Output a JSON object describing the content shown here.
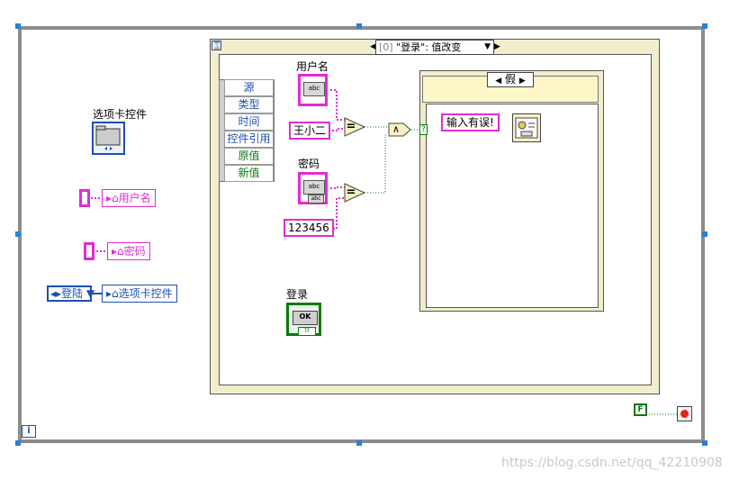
{
  "event_structure": {
    "selector": {
      "index": "[0]",
      "label": "\"登录\": 值改变"
    },
    "data_node": [
      {
        "label": "源",
        "color": "#1d4fb3"
      },
      {
        "label": "类型",
        "color": "#1d4fb3"
      },
      {
        "label": "时间",
        "color": "#1d4fb3"
      },
      {
        "label": "控件引用",
        "color": "#1d4fb3"
      },
      {
        "label": "原值",
        "color": "#0a7a0a"
      },
      {
        "label": "新值",
        "color": "#0a7a0a"
      }
    ]
  },
  "controls": {
    "username_label": "用户名",
    "username_constant": "王小二",
    "password_label": "密码",
    "password_constant": "123456",
    "login_label": "登录",
    "login_button_text": "OK",
    "login_tf_text": "TF"
  },
  "case_structure": {
    "selector": "假",
    "message": "输入有误!"
  },
  "left_column": {
    "tab_control_label": "选项卡控件",
    "username_local": "用户名",
    "password_local": "密码",
    "enum_value": "登陆",
    "tab_local": "选项卡控件"
  },
  "loop": {
    "iteration": "i",
    "false_constant": "F"
  },
  "node_glyphs": {
    "equal": "=",
    "and": "∧",
    "case_q": "?",
    "abc": "abc"
  },
  "colors": {
    "string_wire": "#e22bd6",
    "boolean_wire": "#0a7a0a",
    "enum": "#1d4fb3",
    "frame": "#8c8c8c",
    "structure": "#f2eecd"
  },
  "watermark": "https://blog.csdn.net/qq_42210908"
}
